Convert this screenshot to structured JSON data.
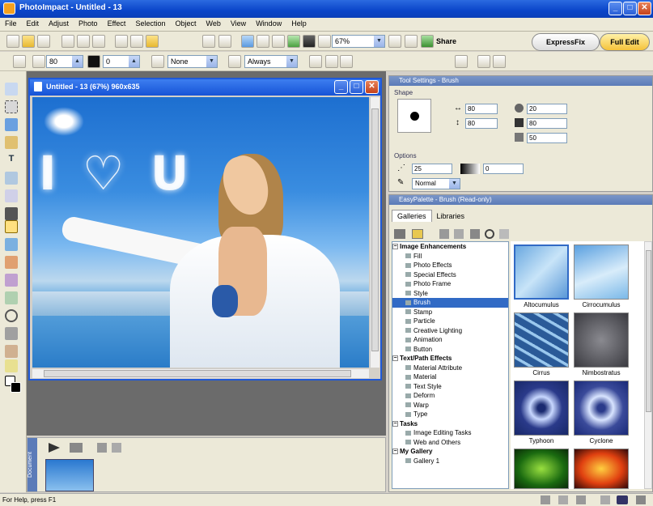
{
  "app": {
    "title": "PhotoImpact - Untitled - 13"
  },
  "menu": [
    "File",
    "Edit",
    "Adjust",
    "Photo",
    "Effect",
    "Selection",
    "Object",
    "Web",
    "View",
    "Window",
    "Help"
  ],
  "toolbar": {
    "zoom_value": "67%",
    "share_label": "Share",
    "expressfix_label": "ExpressFix",
    "fulledit_label": "Full Edit"
  },
  "attrbar": {
    "value1": "80",
    "value2": "0",
    "mode_select": "None",
    "always_select": "Always"
  },
  "document": {
    "title": "Untitled - 13 (67%) 960x635",
    "sky_text": "I ♡ U"
  },
  "tool_settings": {
    "title": "Tool Settings - Brush",
    "shape_label": "Shape",
    "size1": "80",
    "size2": "80",
    "val_a": "20",
    "val_b": "80",
    "val_c": "50",
    "options_label": "Options",
    "opt_value": "25",
    "opt_value2": "0",
    "blend_mode": "Normal"
  },
  "easypalette": {
    "title": "EasyPalette - Brush (Read-only)",
    "tabs": [
      "Galleries",
      "Libraries"
    ],
    "tree": [
      {
        "label": "Image Enhancements",
        "level": 0,
        "bold": true
      },
      {
        "label": "Fill",
        "level": 1
      },
      {
        "label": "Photo Effects",
        "level": 1
      },
      {
        "label": "Special Effects",
        "level": 1
      },
      {
        "label": "Photo Frame",
        "level": 1
      },
      {
        "label": "Style",
        "level": 1
      },
      {
        "label": "Brush",
        "level": 1,
        "selected": true
      },
      {
        "label": "Stamp",
        "level": 1
      },
      {
        "label": "Particle",
        "level": 1
      },
      {
        "label": "Creative Lighting",
        "level": 1
      },
      {
        "label": "Animation",
        "level": 1
      },
      {
        "label": "Button",
        "level": 1
      },
      {
        "label": "Text/Path Effects",
        "level": 0,
        "bold": true
      },
      {
        "label": "Material Attribute",
        "level": 1
      },
      {
        "label": "Material",
        "level": 1
      },
      {
        "label": "Text Style",
        "level": 1
      },
      {
        "label": "Deform",
        "level": 1
      },
      {
        "label": "Warp",
        "level": 1
      },
      {
        "label": "Type",
        "level": 1
      },
      {
        "label": "Tasks",
        "level": 0,
        "bold": true
      },
      {
        "label": "Image Editing Tasks",
        "level": 1
      },
      {
        "label": "Web and Others",
        "level": 1
      },
      {
        "label": "My Gallery",
        "level": 0,
        "bold": true
      },
      {
        "label": "Gallery 1",
        "level": 1
      }
    ],
    "thumbnails": [
      {
        "label": "Altocumulus",
        "color": "#7ab8e8"
      },
      {
        "label": "Cirrocumulus",
        "color": "#8cc4ee"
      },
      {
        "label": "Cirrus",
        "color": "#4a7ab0"
      },
      {
        "label": "Nimbostratus",
        "color": "#5a5a60"
      },
      {
        "label": "Typhoon",
        "color": "#2a3a8a"
      },
      {
        "label": "Cyclone",
        "color": "#3a4a9a"
      },
      {
        "label": "",
        "color": "#2a8a20"
      },
      {
        "label": "",
        "color": "#d04010"
      }
    ]
  },
  "bottom": {
    "tab_label": "Document"
  },
  "status": {
    "text": "For Help, press F1"
  }
}
